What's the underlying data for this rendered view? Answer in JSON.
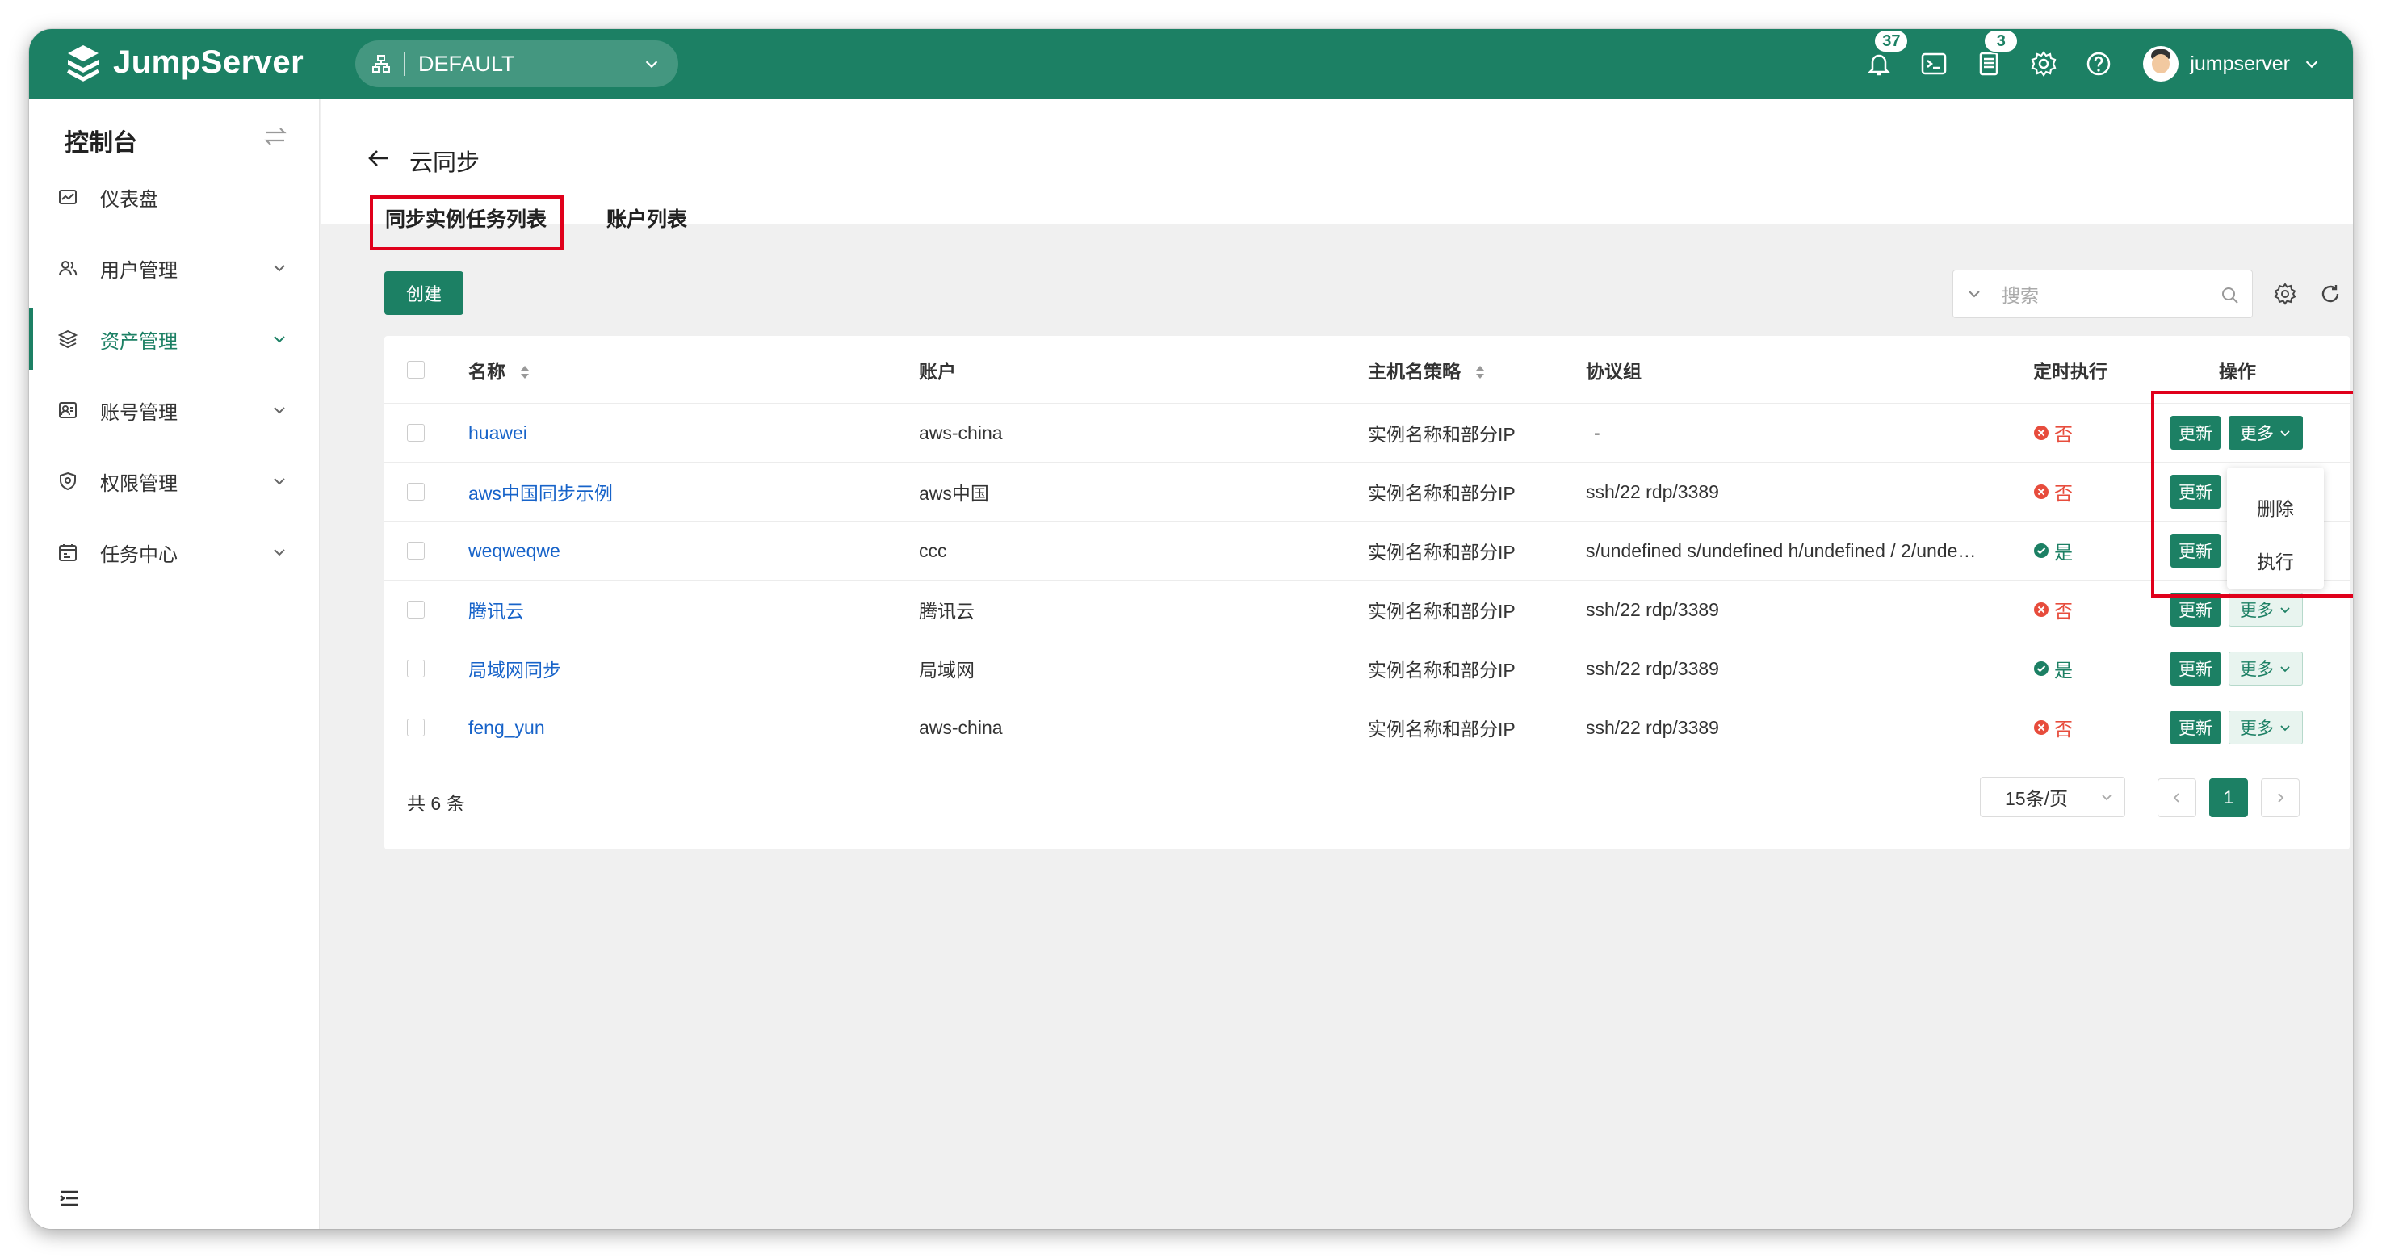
{
  "app": {
    "name": "JumpServer"
  },
  "org": {
    "name": "DEFAULT"
  },
  "topbar": {
    "notifications_count": "37",
    "tickets_count": "3",
    "username": "jumpserver"
  },
  "sidebar": {
    "title": "控制台",
    "items": [
      {
        "label": "仪表盘"
      },
      {
        "label": "用户管理"
      },
      {
        "label": "资产管理"
      },
      {
        "label": "账号管理"
      },
      {
        "label": "权限管理"
      },
      {
        "label": "任务中心"
      }
    ]
  },
  "page": {
    "title": "云同步"
  },
  "tabs": [
    {
      "label": "同步实例任务列表"
    },
    {
      "label": "账户列表"
    }
  ],
  "toolbar": {
    "create_label": "创建",
    "search_placeholder": "搜索"
  },
  "table": {
    "columns": [
      "名称",
      "账户",
      "主机名策略",
      "协议组",
      "定时执行",
      "操作"
    ],
    "rows": [
      {
        "name": "huawei",
        "account": "aws-china",
        "strategy": "实例名称和部分IP",
        "protocols": "-",
        "scheduled": "否"
      },
      {
        "name": "aws中国同步示例",
        "account": "aws中国",
        "strategy": "实例名称和部分IP",
        "protocols": "ssh/22 rdp/3389",
        "scheduled": "否"
      },
      {
        "name": "weqweqwe",
        "account": "ccc",
        "strategy": "实例名称和部分IP",
        "protocols": "s/undefined s/undefined h/undefined / 2/unde…",
        "scheduled": "是"
      },
      {
        "name": "腾讯云",
        "account": "腾讯云",
        "strategy": "实例名称和部分IP",
        "protocols": "ssh/22 rdp/3389",
        "scheduled": "否"
      },
      {
        "name": "局域网同步",
        "account": "局域网",
        "strategy": "实例名称和部分IP",
        "protocols": "ssh/22 rdp/3389",
        "scheduled": "是"
      },
      {
        "name": "feng_yun",
        "account": "aws-china",
        "strategy": "实例名称和部分IP",
        "protocols": "ssh/22 rdp/3389",
        "scheduled": "否"
      }
    ],
    "update_label": "更新",
    "more_label": "更多"
  },
  "dropdown": {
    "items": [
      "删除",
      "执行"
    ]
  },
  "pagination": {
    "total": "共 6 条",
    "page_size": "15条/页",
    "current_page": "1"
  },
  "colors": {
    "brand": "#1c8064",
    "link": "#1763c9",
    "danger": "#e74c3c",
    "highlight": "#e0001b"
  }
}
